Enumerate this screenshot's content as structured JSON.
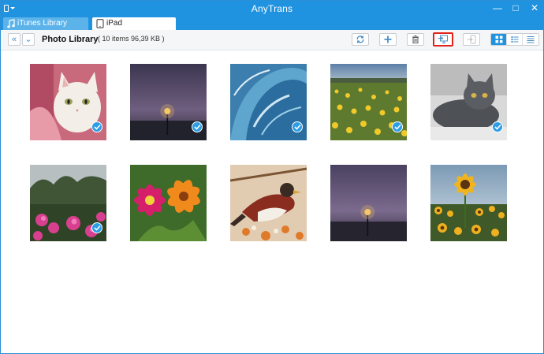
{
  "app": {
    "title": "AnyTrans"
  },
  "window_controls": {
    "minimize": "—",
    "maximize": "□",
    "close": "✕"
  },
  "tabs": [
    {
      "label": "iTunes Library",
      "icon": "music-note-icon",
      "active": false
    },
    {
      "label": "iPad",
      "icon": "ipad-icon",
      "active": true
    }
  ],
  "toolbar": {
    "back_icon": "«",
    "dropdown_icon": "⌄",
    "title": "Photo Library",
    "count": "( 10 items 96,39 KB )",
    "buttons": [
      "refresh-icon",
      "add-icon",
      "delete-icon",
      "send-to-computer-icon",
      "send-to-device-icon"
    ],
    "view_modes": [
      "grid-view-icon",
      "list-detail-icon",
      "list-icon"
    ],
    "selected_view": "grid-view-icon",
    "highlight_color": "#e2231a"
  },
  "photos": [
    {
      "subject": "white kitten on pink fabric",
      "selected": true
    },
    {
      "subject": "purple dusk sky with street lamp",
      "selected": true
    },
    {
      "subject": "blue ocean wave",
      "selected": true
    },
    {
      "subject": "yellow flower field",
      "selected": true
    },
    {
      "subject": "grey cat lying down",
      "selected": true
    },
    {
      "subject": "pink flowers and trees",
      "selected": true
    },
    {
      "subject": "pink and orange flowers",
      "selected": false
    },
    {
      "subject": "bird on flowering branch",
      "selected": false
    },
    {
      "subject": "purple sky with lamp",
      "selected": false
    },
    {
      "subject": "sunflower field",
      "selected": false
    }
  ],
  "colors": {
    "accent": "#1f93e0",
    "check": "#2d9de6"
  }
}
